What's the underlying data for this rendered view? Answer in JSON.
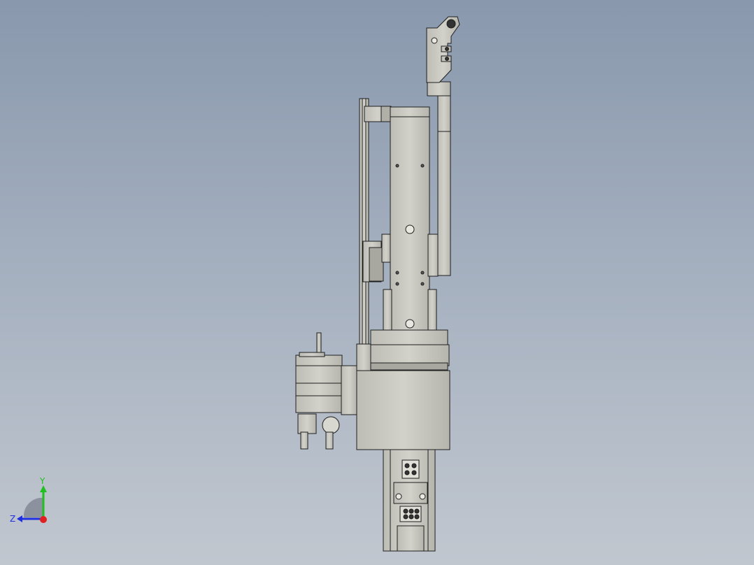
{
  "viewport": {
    "background_top": "#8998ad",
    "background_bottom": "#c1c7cf"
  },
  "model": {
    "part_fill": "#c8c8c0",
    "part_dark": "#8a8a84",
    "edge_color": "#1e1e1e"
  },
  "triad": {
    "x_label": "",
    "y_label": "Y",
    "z_label": "Z",
    "x_color": "#e02020",
    "y_color": "#20c020",
    "z_color": "#2030e0"
  }
}
